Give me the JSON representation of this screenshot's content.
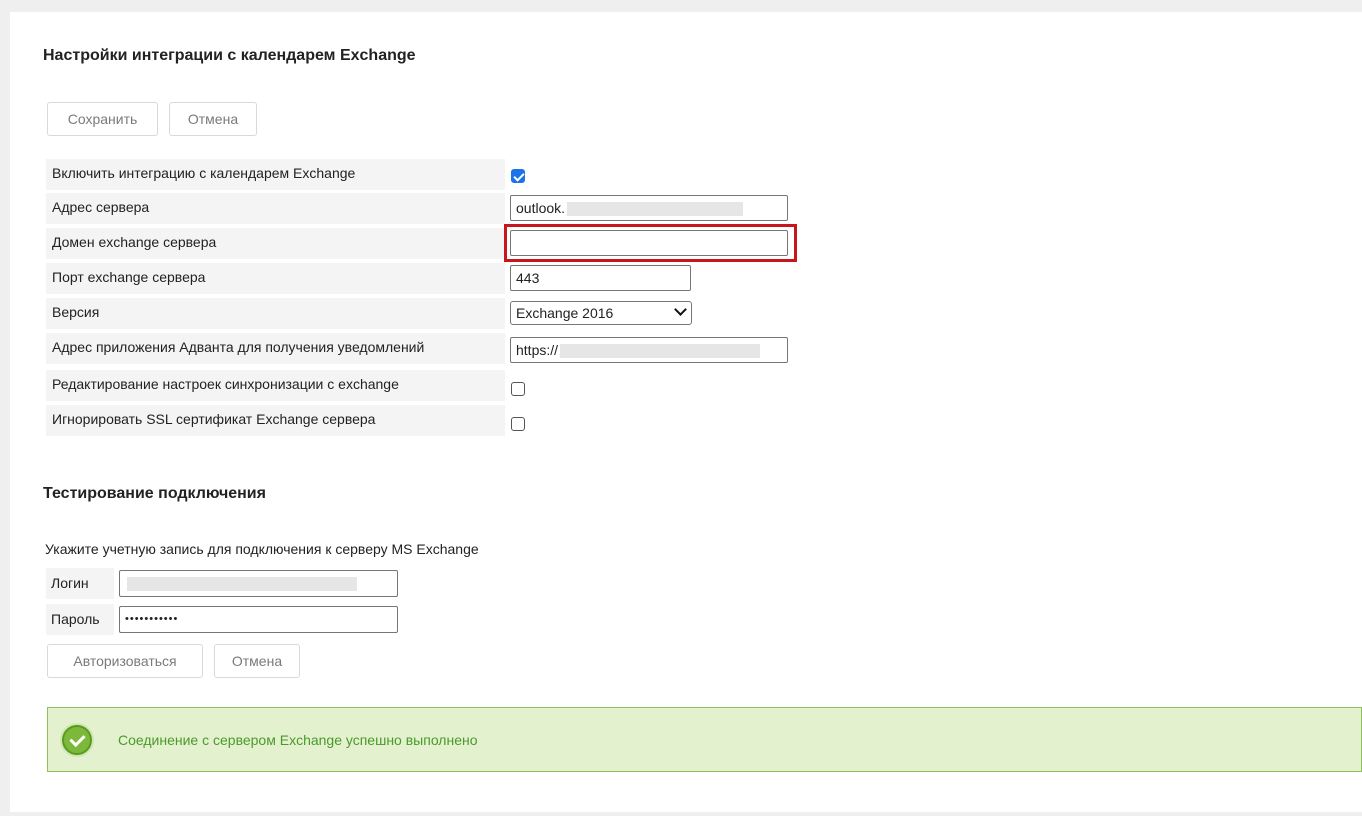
{
  "header": {
    "title": "Настройки интеграции с календарем Exchange"
  },
  "toolbar": {
    "save_label": "Сохранить",
    "cancel_label": "Отмена"
  },
  "settings": {
    "enable_exchange": {
      "label": "Включить интеграцию с календарем Exchange",
      "checked": true
    },
    "server_address": {
      "label": "Адрес сервера",
      "value": "outlook."
    },
    "server_domain": {
      "label": "Домен exchange сервера",
      "value": ""
    },
    "server_port": {
      "label": "Порт exchange сервера",
      "value": "443"
    },
    "version": {
      "label": "Версия",
      "selected": "Exchange 2016"
    },
    "app_address": {
      "label": "Адрес приложения Адванта для получения уведомлений",
      "value": "https://"
    },
    "edit_sync": {
      "label": "Редактирование настроек синхронизации с exchange",
      "checked": false
    },
    "ignore_ssl": {
      "label": "Игнорировать SSL сертификат Exchange сервера",
      "checked": false
    }
  },
  "test": {
    "title": "Тестирование подключения",
    "hint": "Укажите учетную запись для подключения к серверу MS Exchange",
    "login_label": "Логин",
    "login_value": "",
    "password_label": "Пароль",
    "password_value": "•••••••••••",
    "authorize_label": "Авторизоваться",
    "cancel_label": "Отмена"
  },
  "status": {
    "message": "Соединение с сервером Exchange успешно выполнено",
    "color": "#4a9a2a"
  },
  "colors": {
    "highlight": "#c8161d",
    "checkbox_accent": "#1a73e8",
    "success_bg": "#e3f1cf"
  }
}
